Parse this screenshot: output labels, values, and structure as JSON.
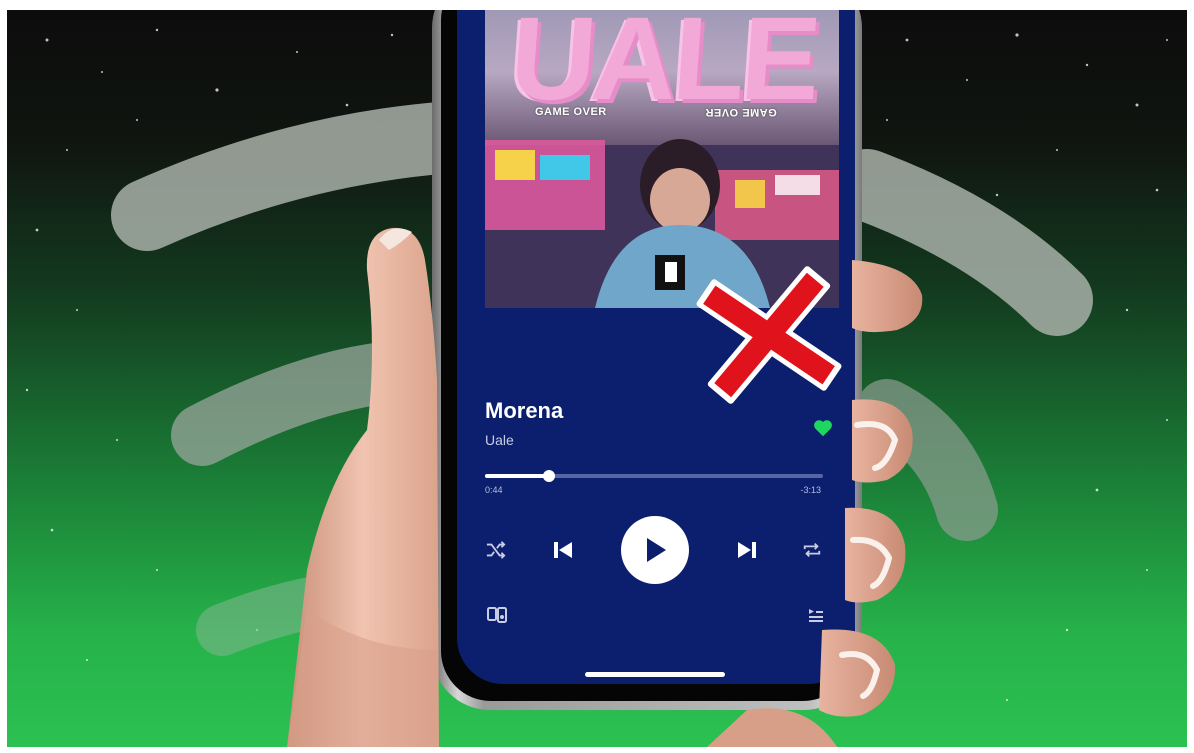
{
  "colors": {
    "spotify_green": "#1ed760",
    "screen_blue": "#0c1f6e",
    "album_pink": "#f2a9d8",
    "x_red": "#e0121b"
  },
  "album": {
    "title": "UALE",
    "subtitle_left": "GAME OVER",
    "subtitle_right": "GAME OVER"
  },
  "track": {
    "title": "Morena",
    "artist": "Uale",
    "liked": true
  },
  "playback": {
    "elapsed": "0:44",
    "remaining": "-3:13",
    "progress_fraction": 0.19
  },
  "icons": {
    "shuffle": "shuffle-icon",
    "previous": "skip-previous-icon",
    "play": "play-icon",
    "next": "skip-next-icon",
    "repeat": "repeat-icon",
    "devices": "connect-devices-icon",
    "queue": "queue-icon",
    "heart": "heart-icon",
    "x_mark": "red-x-icon"
  }
}
